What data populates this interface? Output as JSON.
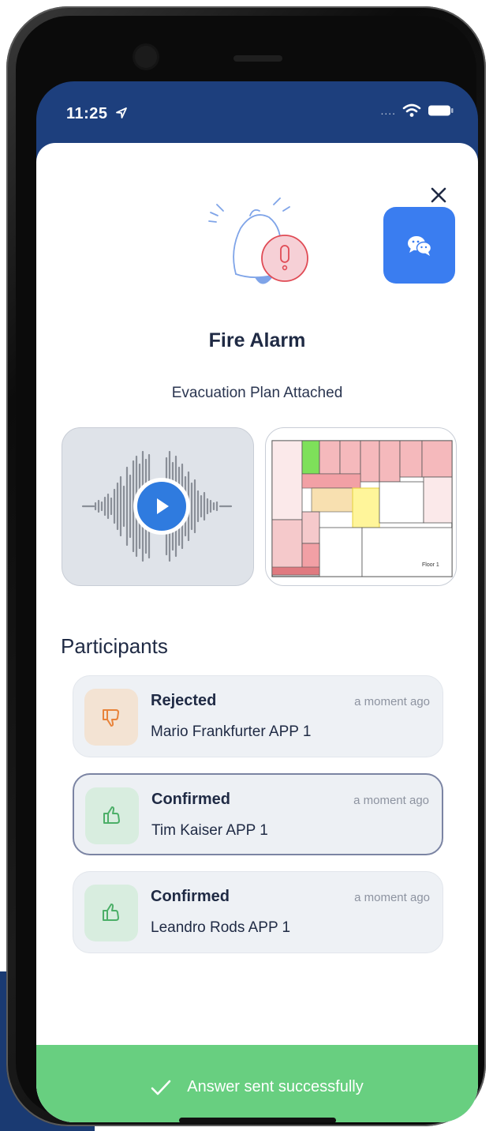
{
  "status_bar": {
    "time": "11:25",
    "signal": "....",
    "icons": [
      "location-arrow-icon",
      "wifi-icon",
      "battery-icon"
    ]
  },
  "alert": {
    "title": "Fire Alarm",
    "subtitle": "Evacuation Plan Attached",
    "icon": "bell-alert-icon",
    "chat_icon": "chat-bubbles-icon",
    "close_icon": "close-icon"
  },
  "attachments": {
    "audio": {
      "icon": "play-icon"
    },
    "plan": {
      "label": "Floor 1"
    }
  },
  "participants": {
    "heading": "Participants",
    "items": [
      {
        "status": "Rejected",
        "name": "Mario Frankfurter APP 1",
        "time": "a moment ago",
        "icon": "thumbs-down-icon"
      },
      {
        "status": "Confirmed",
        "name": "Tim Kaiser APP 1",
        "time": "a moment ago",
        "icon": "thumbs-up-icon"
      },
      {
        "status": "Confirmed",
        "name": "Leandro Rods APP 1",
        "time": "a moment ago",
        "icon": "thumbs-up-icon"
      }
    ]
  },
  "toast": {
    "message": "Answer sent successfully",
    "icon": "checkmark-icon"
  },
  "colors": {
    "header_blue": "#1d3f7d",
    "accent_blue": "#3a7df0",
    "success_green": "#68cf80",
    "rejected_orange": "#e8833a",
    "confirmed_green": "#4caf68",
    "alert_red": "#e04b55"
  }
}
